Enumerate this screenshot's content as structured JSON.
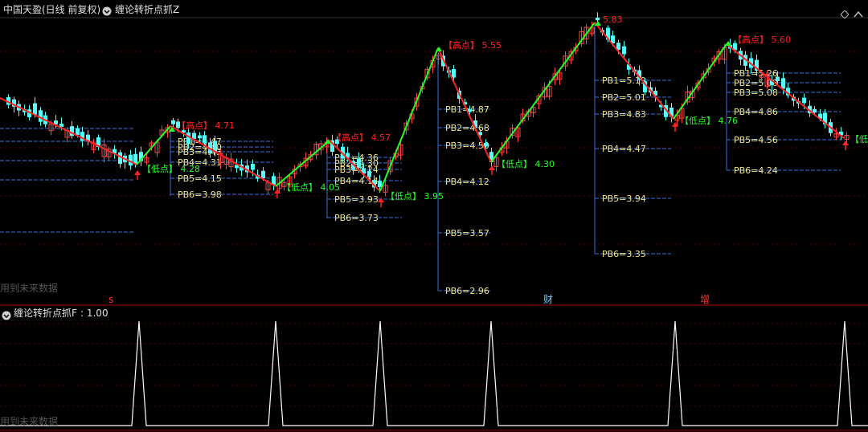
{
  "header": {
    "stock_name": "中国天盈",
    "period": "(日线 前复权)",
    "indicator": "缠论转折点抓Z"
  },
  "sub_panel": {
    "title": "缠论转折点抓F",
    "value_text": ": 1.00"
  },
  "watermark_main": "用到未来数据",
  "watermark_sub": "用到未来数据",
  "event_markers": [
    {
      "label": "s",
      "color": "#ff3333"
    },
    {
      "label": "财",
      "color": "#66ccff"
    },
    {
      "label": "增",
      "color": "#ff3333"
    }
  ],
  "colors": {
    "background": "#000000",
    "up_candle": "#ff4444",
    "down_candle": "#55ffff",
    "high_line": "#ff2222",
    "low_line": "#22ff22",
    "pb_line": "#3a6fd8",
    "pb_text": "#f0e68c",
    "signal": "#ffffff",
    "divider": "#aa0000"
  },
  "chart_data": {
    "type": "candlestick",
    "ylim": [
      2.9,
      5.9
    ],
    "pivots": [
      {
        "kind": "high",
        "label": "【高点】",
        "value": "4.71"
      },
      {
        "kind": "low",
        "label": "【低点】",
        "value": "4.28"
      },
      {
        "kind": "high",
        "label": "【高点】",
        "value": "4.57"
      },
      {
        "kind": "low",
        "label": "【低点】",
        "value": "4.05"
      },
      {
        "kind": "low",
        "label": "【低点】",
        "value": "3.95"
      },
      {
        "kind": "high",
        "label": "【高点】",
        "value": "5.55"
      },
      {
        "kind": "low",
        "label": "【低点】",
        "value": "4.30"
      },
      {
        "kind": "high",
        "label": "",
        "value": "5.83"
      },
      {
        "kind": "high",
        "label": "【高点】",
        "value": "5.60"
      },
      {
        "kind": "low",
        "label": "【低点】",
        "value": "4.76"
      },
      {
        "kind": "low",
        "label": "【低点】",
        "value": ""
      }
    ],
    "pb_groups": [
      {
        "levels": [
          "PB1=4.47",
          "PB2=4.40",
          "PB3=4.43",
          "PB4=4.31",
          "PB5=4.15",
          "PB6=3.98"
        ]
      },
      {
        "levels": [
          "PB1=4.36",
          "PB2=4.30",
          "PB3=4.24",
          "PB4=4.14",
          "PB5=3.93",
          "PB6=3.73"
        ]
      },
      {
        "levels": [
          "PB1=4.87",
          "PB2=4.68",
          "PB3=4.50",
          "PB4=4.12",
          "PB5=3.57",
          "PB6=2.96"
        ]
      },
      {
        "levels": [
          "PB1=5.19",
          "PB2=5.01",
          "PB3=4.83",
          "PB4=4.47",
          "PB5=3.94",
          "PB6=3.35"
        ]
      },
      {
        "levels": [
          "PB1=5.26",
          "PB2=5.08",
          "PB3=5.08",
          "PB4=4.86",
          "PB5=4.56",
          "PB6=4.24"
        ]
      }
    ]
  }
}
